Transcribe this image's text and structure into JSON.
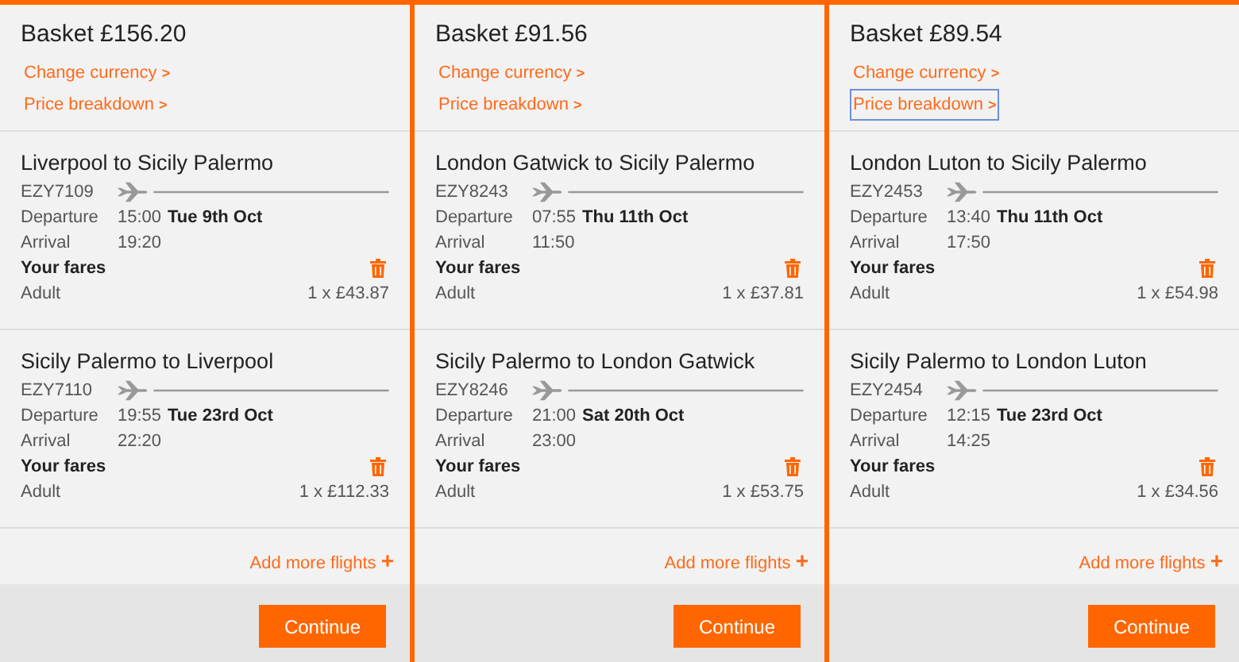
{
  "baskets": [
    {
      "title": "Basket £156.20",
      "links": [
        {
          "label": "Change currency",
          "arrow": ">",
          "focused": false
        },
        {
          "label": "Price breakdown",
          "arrow": ">",
          "focused": false
        }
      ],
      "flights": [
        {
          "route": "Liverpool to Sicily Palermo",
          "code": "EZY7109",
          "departure_label": "Departure",
          "departure_time": "15:00",
          "departure_date": "Tue 9th Oct",
          "arrival_label": "Arrival",
          "arrival_time": "19:20",
          "fares_label": "Your fares",
          "passenger": "Adult",
          "price": "1 x £43.87"
        },
        {
          "route": "Sicily Palermo to Liverpool",
          "code": "EZY7110",
          "departure_label": "Departure",
          "departure_time": "19:55",
          "departure_date": "Tue 23rd Oct",
          "arrival_label": "Arrival",
          "arrival_time": "22:20",
          "fares_label": "Your fares",
          "passenger": "Adult",
          "price": "1 x £112.33"
        }
      ],
      "add_more": "Add more flights",
      "add_icon": "+",
      "continue": "Continue"
    },
    {
      "title": "Basket £91.56",
      "links": [
        {
          "label": "Change currency",
          "arrow": ">",
          "focused": false
        },
        {
          "label": "Price breakdown",
          "arrow": ">",
          "focused": false
        }
      ],
      "flights": [
        {
          "route": "London Gatwick to Sicily Palermo",
          "code": "EZY8243",
          "departure_label": "Departure",
          "departure_time": "07:55",
          "departure_date": "Thu 11th Oct",
          "arrival_label": "Arrival",
          "arrival_time": "11:50",
          "fares_label": "Your fares",
          "passenger": "Adult",
          "price": "1 x £37.81"
        },
        {
          "route": "Sicily Palermo to London Gatwick",
          "code": "EZY8246",
          "departure_label": "Departure",
          "departure_time": "21:00",
          "departure_date": "Sat 20th Oct",
          "arrival_label": "Arrival",
          "arrival_time": "23:00",
          "fares_label": "Your fares",
          "passenger": "Adult",
          "price": "1 x £53.75"
        }
      ],
      "add_more": "Add more flights",
      "add_icon": "+",
      "continue": "Continue"
    },
    {
      "title": "Basket £89.54",
      "links": [
        {
          "label": "Change currency",
          "arrow": ">",
          "focused": false
        },
        {
          "label": "Price breakdown",
          "arrow": ">",
          "focused": true
        }
      ],
      "flights": [
        {
          "route": "London Luton to Sicily Palermo",
          "code": "EZY2453",
          "departure_label": "Departure",
          "departure_time": "13:40",
          "departure_date": "Thu 11th Oct",
          "arrival_label": "Arrival",
          "arrival_time": "17:50",
          "fares_label": "Your fares",
          "passenger": "Adult",
          "price": "1 x £54.98"
        },
        {
          "route": "Sicily Palermo to London Luton",
          "code": "EZY2454",
          "departure_label": "Departure",
          "departure_time": "12:15",
          "departure_date": "Tue 23rd Oct",
          "arrival_label": "Arrival",
          "arrival_time": "14:25",
          "fares_label": "Your fares",
          "passenger": "Adult",
          "price": "1 x £34.56"
        }
      ],
      "add_more": "Add more flights",
      "add_icon": "+",
      "continue": "Continue"
    }
  ]
}
